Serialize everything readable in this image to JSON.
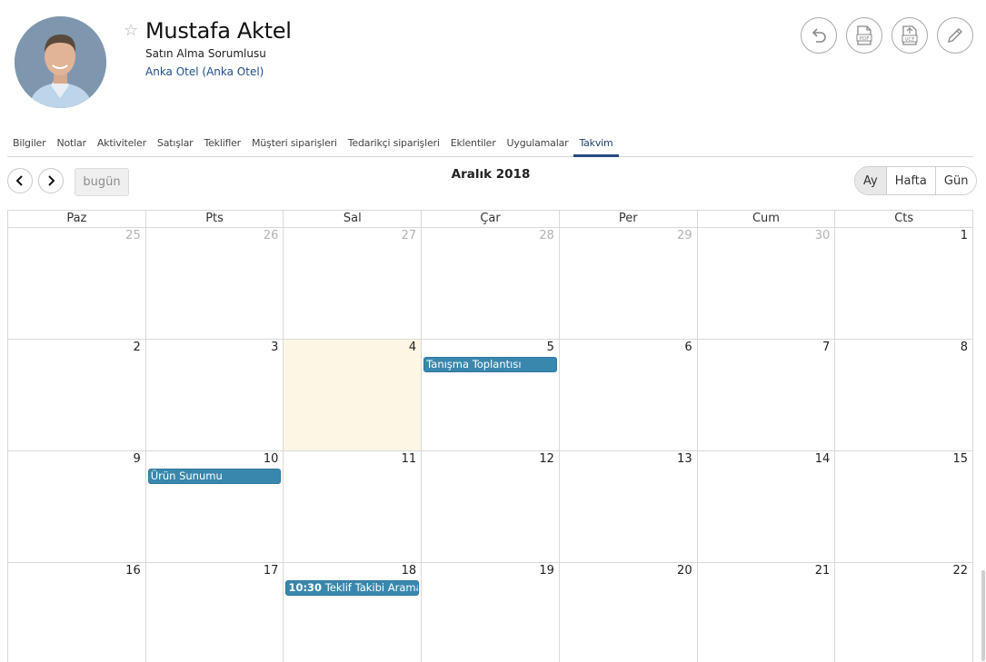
{
  "contact": {
    "name": "Mustafa Aktel",
    "role": "Satın Alma Sorumlusu",
    "company": "Anka Otel (Anka Otel)",
    "favorite_icon": "star-outline-icon"
  },
  "actions": [
    {
      "name": "undo-button",
      "icon": "undo-icon"
    },
    {
      "name": "pdf-export-button",
      "icon": "pdf-icon"
    },
    {
      "name": "vcf-export-button",
      "icon": "vcf-icon"
    },
    {
      "name": "edit-button",
      "icon": "pencil-icon"
    }
  ],
  "tabs": [
    {
      "label": "Bilgiler"
    },
    {
      "label": "Notlar"
    },
    {
      "label": "Aktiviteler"
    },
    {
      "label": "Satışlar"
    },
    {
      "label": "Teklifler"
    },
    {
      "label": "Müşteri siparişleri"
    },
    {
      "label": "Tedarikçi siparişleri"
    },
    {
      "label": "Eklentiler"
    },
    {
      "label": "Uygulamalar"
    },
    {
      "label": "Takvim",
      "active": true
    }
  ],
  "calendar": {
    "title": "Aralık 2018",
    "today_label": "bugün",
    "views": [
      {
        "label": "Ay",
        "active": true
      },
      {
        "label": "Hafta"
      },
      {
        "label": "Gün"
      }
    ],
    "weekdays": [
      "Paz",
      "Pts",
      "Sal",
      "Çar",
      "Per",
      "Cum",
      "Cts"
    ],
    "weeks": [
      [
        {
          "n": "25",
          "other": true
        },
        {
          "n": "26",
          "other": true
        },
        {
          "n": "27",
          "other": true
        },
        {
          "n": "28",
          "other": true
        },
        {
          "n": "29",
          "other": true
        },
        {
          "n": "30",
          "other": true
        },
        {
          "n": "1"
        }
      ],
      [
        {
          "n": "2"
        },
        {
          "n": "3"
        },
        {
          "n": "4",
          "today": true
        },
        {
          "n": "5",
          "event": {
            "title": "Tanışma Toplantısı"
          }
        },
        {
          "n": "6"
        },
        {
          "n": "7"
        },
        {
          "n": "8"
        }
      ],
      [
        {
          "n": "9"
        },
        {
          "n": "10",
          "event": {
            "title": "Ürün Sunumu"
          }
        },
        {
          "n": "11"
        },
        {
          "n": "12"
        },
        {
          "n": "13"
        },
        {
          "n": "14"
        },
        {
          "n": "15"
        }
      ],
      [
        {
          "n": "16"
        },
        {
          "n": "17"
        },
        {
          "n": "18",
          "event": {
            "time": "10:30",
            "title": "Teklif Takibi Araması"
          }
        },
        {
          "n": "19"
        },
        {
          "n": "20"
        },
        {
          "n": "21"
        },
        {
          "n": "22"
        }
      ]
    ],
    "event_color": "#3a87ad",
    "today_color": "#fcf7e4"
  }
}
